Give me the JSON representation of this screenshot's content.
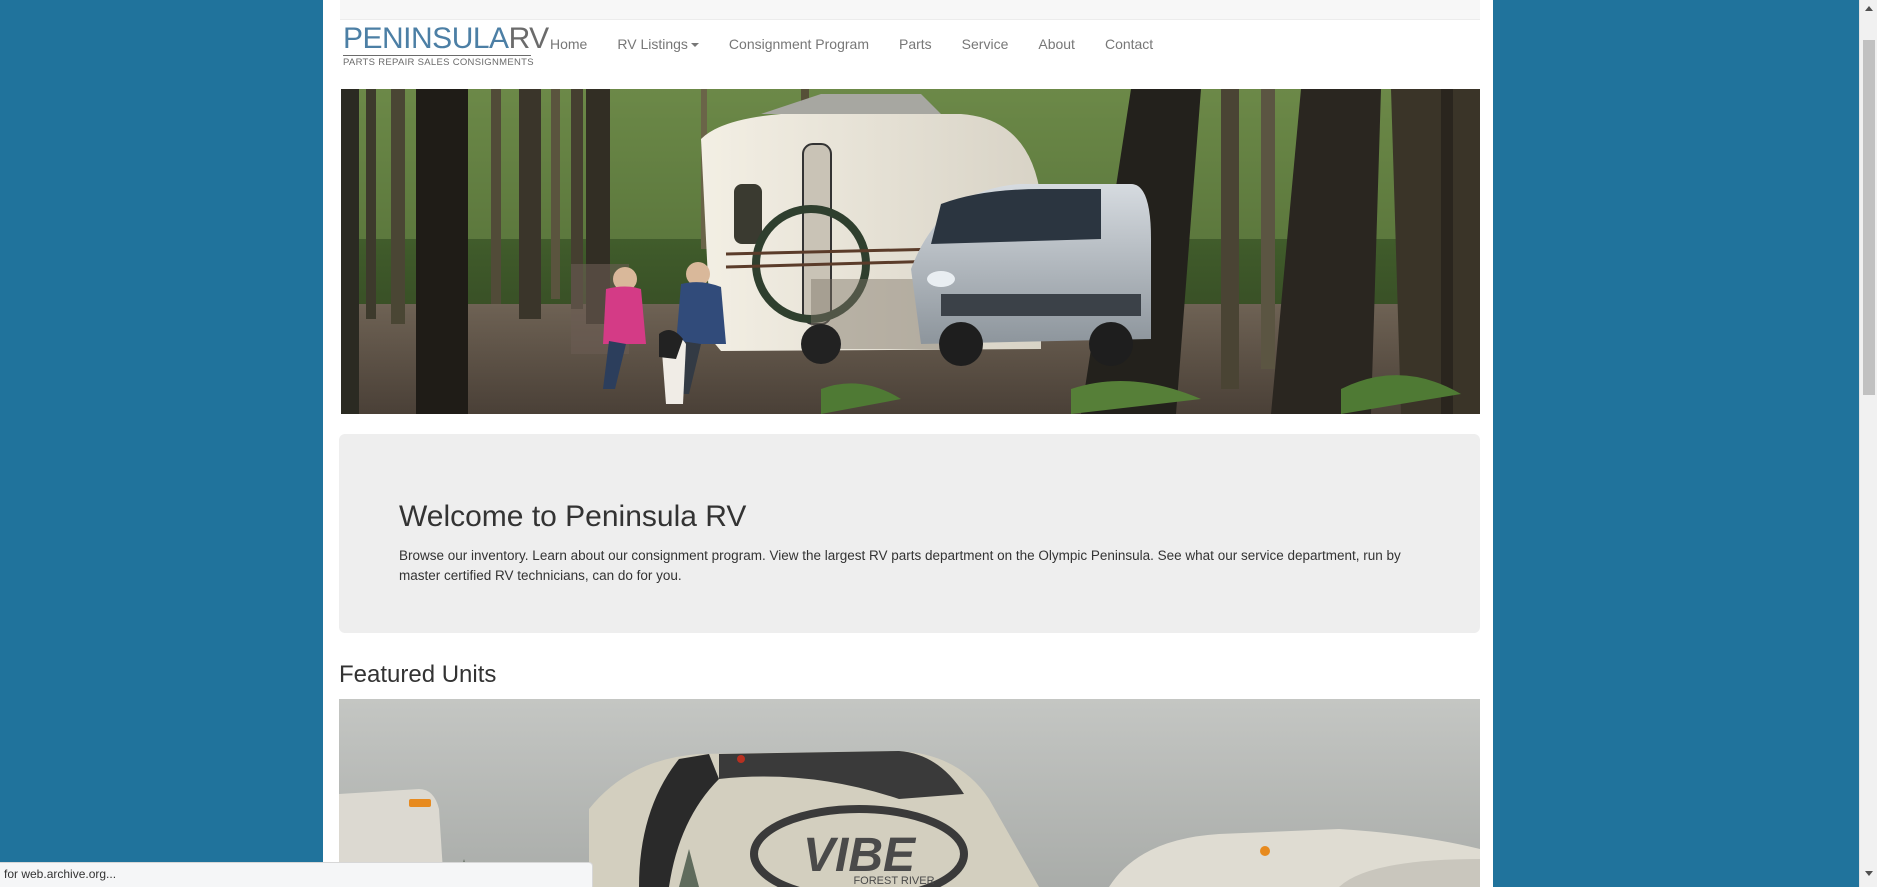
{
  "brand": {
    "name_main": "PENINSULA",
    "name_rv": "RV",
    "tagline": "PARTS  REPAIR  SALES  CONSIGNMENTS"
  },
  "nav": {
    "items": [
      {
        "label": "Home"
      },
      {
        "label": "RV Listings",
        "dropdown": true
      },
      {
        "label": "Consignment Program"
      },
      {
        "label": "Parts"
      },
      {
        "label": "Service"
      },
      {
        "label": "About"
      },
      {
        "label": "Contact"
      }
    ]
  },
  "jumbotron": {
    "title": "Welcome to Peninsula RV",
    "text": "Browse our inventory. Learn about our consignment program. View the largest RV parts department on the Olympic Peninsula. See what our service department, run by master certified RV technicians, can do for you."
  },
  "featured": {
    "title": "Featured Units",
    "image_text": "VIBE",
    "image_subtext": "FOREST RIVER"
  },
  "status": {
    "text": "g for web.archive.org..."
  },
  "colors": {
    "background": "#20739c",
    "brand_blue": "#4c7fa5",
    "jumbotron_bg": "#eeeeee"
  }
}
